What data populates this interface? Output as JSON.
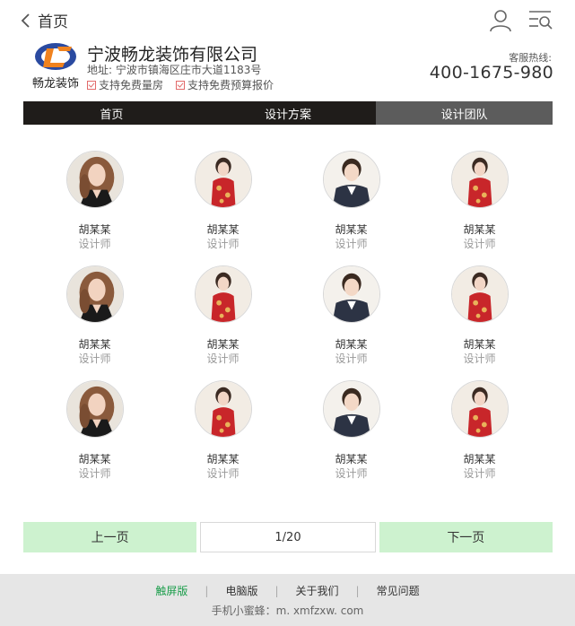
{
  "topbar": {
    "back_label": "首页"
  },
  "company": {
    "logo_text": "畅龙装饰",
    "name": "宁波畅龙装饰有限公司",
    "address": "地址: 宁波市镇海区庄市大道1183号",
    "features": [
      "支持免费量房",
      "支持免费预算报价"
    ],
    "hotline_label": "客服热线:",
    "hotline_number": "400-1675-980"
  },
  "nav": {
    "items": [
      "首页",
      "设计方案",
      "设计团队"
    ],
    "active_index": 2
  },
  "team": {
    "members": [
      {
        "name": "胡某某",
        "title": "设计师",
        "photo": "photo-woman-long-hair"
      },
      {
        "name": "胡某某",
        "title": "设计师",
        "photo": "photo-woman-red-dress"
      },
      {
        "name": "胡某某",
        "title": "设计师",
        "photo": "photo-woman-suit"
      },
      {
        "name": "胡某某",
        "title": "设计师",
        "photo": "photo-woman-red-dress"
      },
      {
        "name": "胡某某",
        "title": "设计师",
        "photo": "photo-woman-long-hair"
      },
      {
        "name": "胡某某",
        "title": "设计师",
        "photo": "photo-woman-red-dress"
      },
      {
        "name": "胡某某",
        "title": "设计师",
        "photo": "photo-woman-suit"
      },
      {
        "name": "胡某某",
        "title": "设计师",
        "photo": "photo-woman-red-dress"
      },
      {
        "name": "胡某某",
        "title": "设计师",
        "photo": "photo-woman-long-hair"
      },
      {
        "name": "胡某某",
        "title": "设计师",
        "photo": "photo-woman-red-dress"
      },
      {
        "name": "胡某某",
        "title": "设计师",
        "photo": "photo-woman-suit"
      },
      {
        "name": "胡某某",
        "title": "设计师",
        "photo": "photo-woman-red-dress"
      }
    ]
  },
  "pager": {
    "prev_label": "上一页",
    "page_indicator": "1/20",
    "next_label": "下一页"
  },
  "footer": {
    "links": [
      "触屏版",
      "电脑版",
      "关于我们",
      "常见问题"
    ],
    "active_index": 0,
    "site_line": "手机小蜜蜂：m. xmfzxw. com"
  },
  "colors": {
    "nav_bg": "#1f1c1a",
    "nav_active": "#5c5c5c",
    "pager_btn": "#cdf2cf",
    "footer_bg": "#e6e6e6",
    "footer_active": "#1a9d4a",
    "check": "#e26a6a"
  }
}
